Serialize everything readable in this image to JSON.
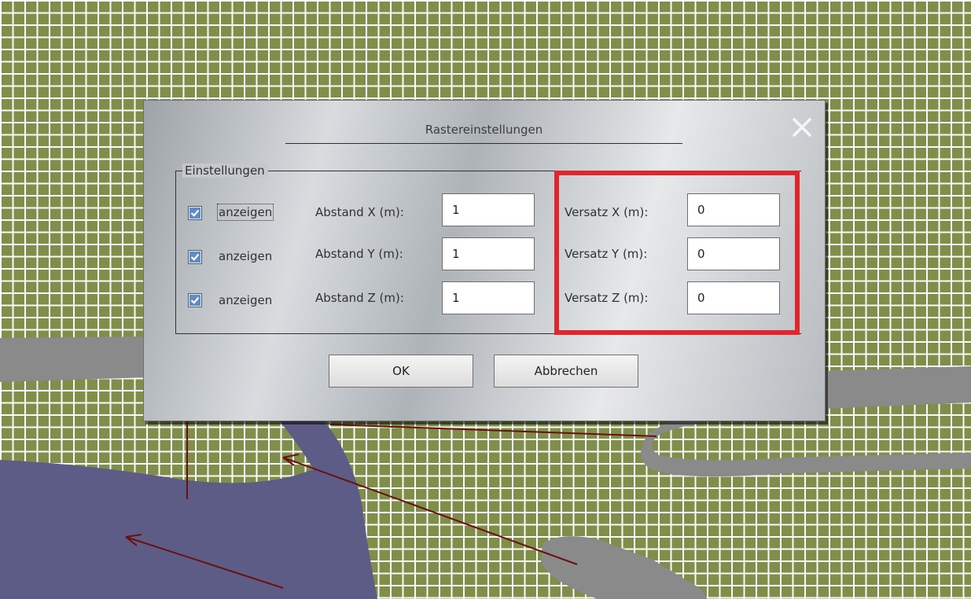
{
  "background": {
    "grid_color": "#7f8e4a",
    "road_color": "#8a8a8a",
    "river_color": "#5d5c86",
    "line_color": "#6b1010"
  },
  "dialog": {
    "title": "Rastereinstellungen",
    "close_icon": "close-icon",
    "group_label": "Einstellungen",
    "rows": [
      {
        "checkbox_checked": true,
        "checkbox_label": "anzeigen",
        "spacing_label": "Abstand X (m):",
        "spacing_value": "1",
        "offset_label": "Versatz X (m):",
        "offset_value": "0"
      },
      {
        "checkbox_checked": true,
        "checkbox_label": "anzeigen",
        "spacing_label": "Abstand Y (m):",
        "spacing_value": "1",
        "offset_label": "Versatz Y (m):",
        "offset_value": "0"
      },
      {
        "checkbox_checked": true,
        "checkbox_label": "anzeigen",
        "spacing_label": "Abstand Z (m):",
        "spacing_value": "1",
        "offset_label": "Versatz Z (m):",
        "offset_value": "0"
      }
    ],
    "highlight_color": "#e0252c",
    "ok_label": "OK",
    "cancel_label": "Abbrechen"
  }
}
